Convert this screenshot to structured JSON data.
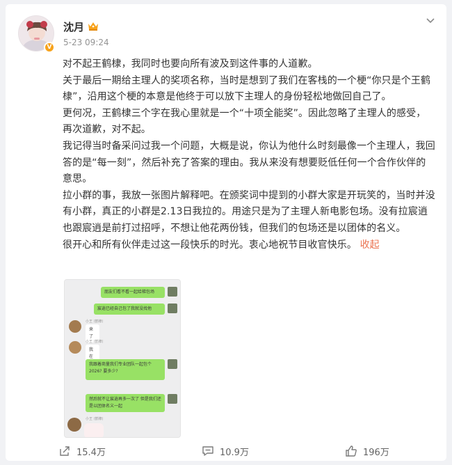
{
  "post": {
    "username": "沈月",
    "timestamp": "5-23 09:24",
    "paragraphs": [
      "对不起王鹤棣，我同时也要向所有波及到这件事的人道歉。",
      "关于最后一期给主理人的奖项名称，当时是想到了我们在客栈的一个梗“你只是个王鹤棣”，沿用这个梗的本意是他终于可以放下主理人的身份轻松地做回自己了。",
      "更何况，王鹤棣三个字在我心里就是一个“十项全能奖”。因此忽略了主理人的感受，再次道歉，对不起。",
      "我记得当时备采问过我一个问题，大概是说，你认为他什么时刻最像一个主理人，我回答的是“每一刻”，然后补充了答案的理由。我从来没有想要贬低任何一个合作伙伴的意思。",
      "拉小群的事，我放一张图片解释吧。在颁奖词中提到的小群大家是开玩笑的，当时并没有小群，真正的小群是2.13日我拉的。用途只是为了主理人新电影包场。没有拉宸逍也跟宸逍是前打过招呼，不想让他花两份钱，但我们的包场还是以团体的名义。"
    ],
    "last_paragraph": "很开心和所有伙伴走过这一段快乐的时光。衷心地祝节目收官快乐。",
    "collapse_label": "收起"
  },
  "chat": {
    "messages": [
      {
        "side": "right",
        "text": "朋友们看不看一起给梯包场"
      },
      {
        "side": "right",
        "text": "宸逍已经自己包了我就没找他"
      },
      {
        "side": "left",
        "name": "小王 (鹤棣)",
        "text": "来了"
      },
      {
        "side": "left",
        "name": "小王 (鹤棣)",
        "text": "我在"
      },
      {
        "side": "right",
        "text": "我跟着商量我们专业团队一起包个2026? 要多少?"
      },
      {
        "side": "right",
        "text": "然后就不让宸逍再多一次了 但是我们还是以团体名义一起"
      },
      {
        "side": "left",
        "name": "小王 (鹤棣)",
        "text": ""
      }
    ]
  },
  "toolbar": {
    "share_count": "15.4万",
    "comment_count": "10.9万",
    "like_count": "196万"
  },
  "colors": {
    "link": "#eb7350",
    "crown": "#f7a21b",
    "chat_green": "#98e165"
  }
}
